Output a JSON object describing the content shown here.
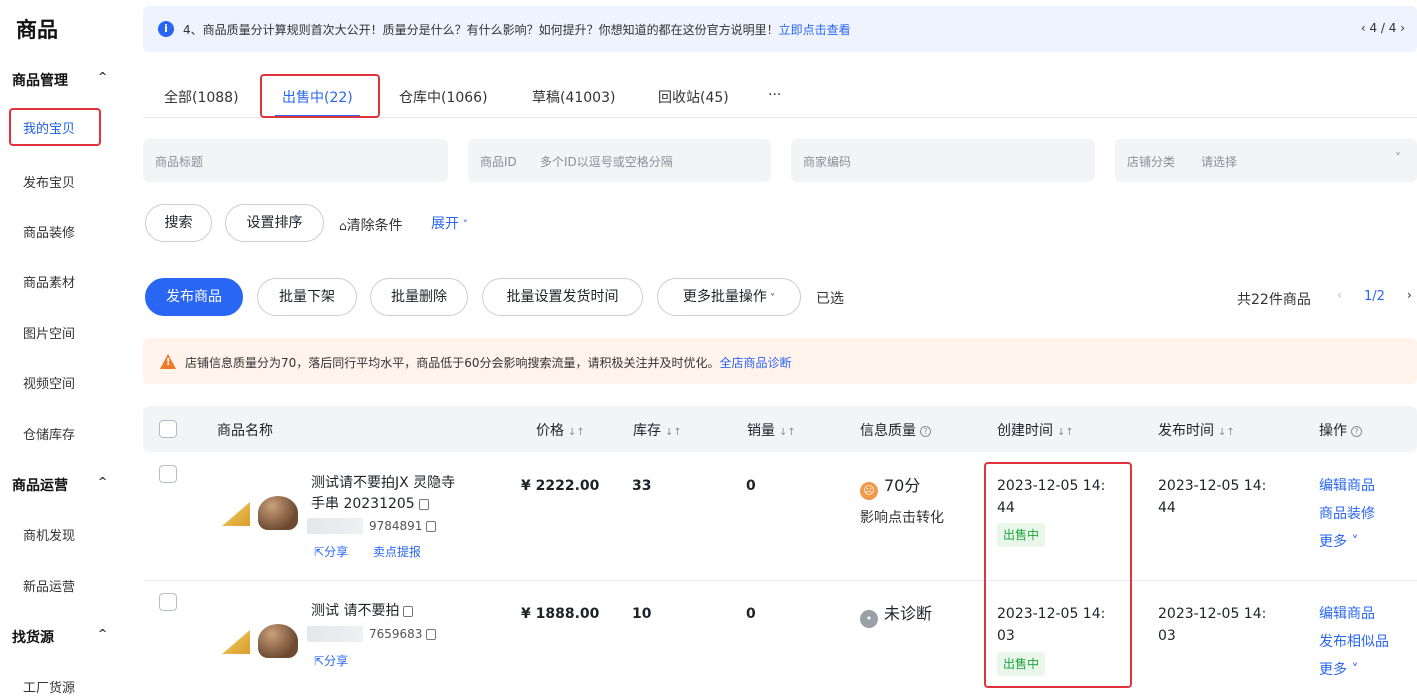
{
  "sidebar": {
    "title": "商品",
    "groups": [
      {
        "label": "商品管理",
        "items": [
          "我的宝贝",
          "发布宝贝",
          "商品装修",
          "商品素材",
          "图片空间",
          "视频空间",
          "仓储库存"
        ]
      },
      {
        "label": "商品运营",
        "items": [
          "商机发现",
          "新品运营"
        ]
      },
      {
        "label": "找货源",
        "items": [
          "工厂货源"
        ]
      }
    ],
    "active_item": "我的宝贝"
  },
  "notice": {
    "icon": "info-icon",
    "text": "4、商品质量分计算规则首次大公开！质量分是什么？有什么影响？如何提升？你想知道的都在这份官方说明里！",
    "link": "立即点击查看",
    "pager": "‹ 4 / 4 ›"
  },
  "tabs": [
    {
      "label": "全部(1088)"
    },
    {
      "label": "出售中(22)"
    },
    {
      "label": "仓库中(1066)"
    },
    {
      "label": "草稿(41003)"
    },
    {
      "label": "回收站(45)"
    },
    {
      "label": "···"
    }
  ],
  "filters": {
    "title_label": "商品标题",
    "id_label": "商品ID",
    "id_placeholder": "多个ID以逗号或空格分隔",
    "code_label": "商家编码",
    "category_label": "店铺分类",
    "category_placeholder": "请选择"
  },
  "search_actions": {
    "search": "搜索",
    "set_sort": "设置排序",
    "clear": "清除条件",
    "expand": "展开"
  },
  "batch_actions": {
    "publish": "发布商品",
    "batch_off": "批量下架",
    "batch_delete": "批量删除",
    "batch_ship_time": "批量设置发货时间",
    "more_batch": "更多批量操作",
    "selected": "已选",
    "total": "共22件商品",
    "page": "1/2"
  },
  "warning": {
    "text": "店铺信息质量分为70，落后同行平均水平，商品低于60分会影响搜索流量，请积极关注并及时优化。",
    "link": "全店商品诊断"
  },
  "table": {
    "headers": {
      "name": "商品名称",
      "price": "价格",
      "stock": "库存",
      "sales": "销量",
      "quality": "信息质量",
      "created": "创建时间",
      "published": "发布时间",
      "ops": "操作"
    },
    "rows": [
      {
        "name_line1": "测试请不要拍JX 灵隐寺",
        "name_line2": "手串 20231205",
        "id_suffix": "9784891",
        "links": [
          "分享",
          "卖点提报"
        ],
        "price": "¥ 2222.00",
        "stock": "33",
        "sales": "0",
        "quality_score": "70分",
        "quality_note": "影响点击转化",
        "created_line1": "2023-12-05 14:",
        "created_line2": "44",
        "status": "出售中",
        "published_line1": "2023-12-05 14:",
        "published_line2": "44",
        "ops": [
          "编辑商品",
          "商品装修",
          "更多 ˅"
        ]
      },
      {
        "name_line1": "测试 请不要拍",
        "id_suffix": "7659683",
        "links": [
          "分享"
        ],
        "price": "¥ 1888.00",
        "stock": "10",
        "sales": "0",
        "quality_score": "未诊断",
        "created_line1": "2023-12-05 14:",
        "created_line2": "03",
        "status": "出售中",
        "published_line1": "2023-12-05 14:",
        "published_line2": "03",
        "ops": [
          "编辑商品",
          "发布相似品",
          "更多 ˅"
        ]
      }
    ]
  },
  "colors": {
    "accent": "#2a66f4",
    "highlight_frame": "#e0343c",
    "status_green": "#1ea33a",
    "warning_orange": "#f07a2a"
  }
}
